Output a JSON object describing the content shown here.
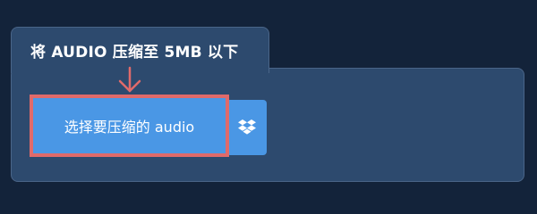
{
  "panel": {
    "title": "将 AUDIO 压缩至 5MB 以下"
  },
  "upload": {
    "choose_label": "选择要压缩的 audio",
    "dropbox_icon": "dropbox-icon"
  },
  "annotation": {
    "arrow_icon": "arrow-down-icon",
    "highlight_color": "#e06a6a"
  },
  "colors": {
    "background": "#13233a",
    "panel": "#2d4a6e",
    "button": "#4a97e5"
  }
}
